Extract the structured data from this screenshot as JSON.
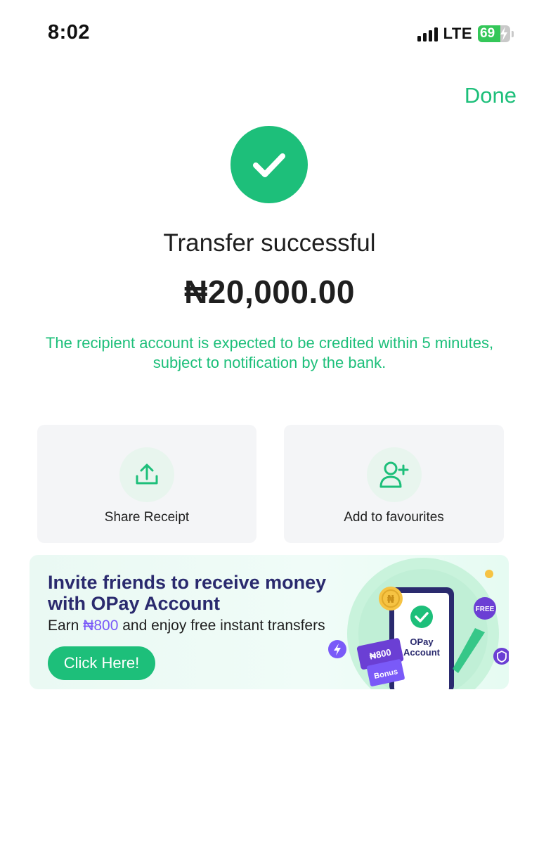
{
  "status_bar": {
    "time": "8:02",
    "network": "LTE",
    "battery_level": "69",
    "battery_percent": 69
  },
  "header": {
    "done_label": "Done"
  },
  "result": {
    "title": "Transfer successful",
    "amount": "₦20,000.00",
    "note": "The recipient account is expected to be credited within 5 minutes, subject to notification by the bank."
  },
  "actions": [
    {
      "label": "Share Receipt",
      "icon": "share-upload-icon"
    },
    {
      "label": "Add to favourites",
      "icon": "add-user-icon"
    }
  ],
  "banner": {
    "headline_line1": "Invite friends to receive money",
    "headline_line2": "with OPay Account",
    "sub_prefix": "Earn ",
    "sub_highlight": "₦800",
    "sub_suffix": " and enjoy free instant transfers",
    "button_label": "Click Here!",
    "art": {
      "phone_text_1": "OPay",
      "phone_text_2": "Account",
      "ticket_amount": "₦800",
      "ticket_label": "Bonus",
      "free_badge": "FREE",
      "coin_symbol": "₦"
    }
  },
  "colors": {
    "accent": "#1dbf7a",
    "banner_headline": "#2a2a6e",
    "banner_highlight": "#7a5af8",
    "card_bg": "#f4f5f7"
  }
}
